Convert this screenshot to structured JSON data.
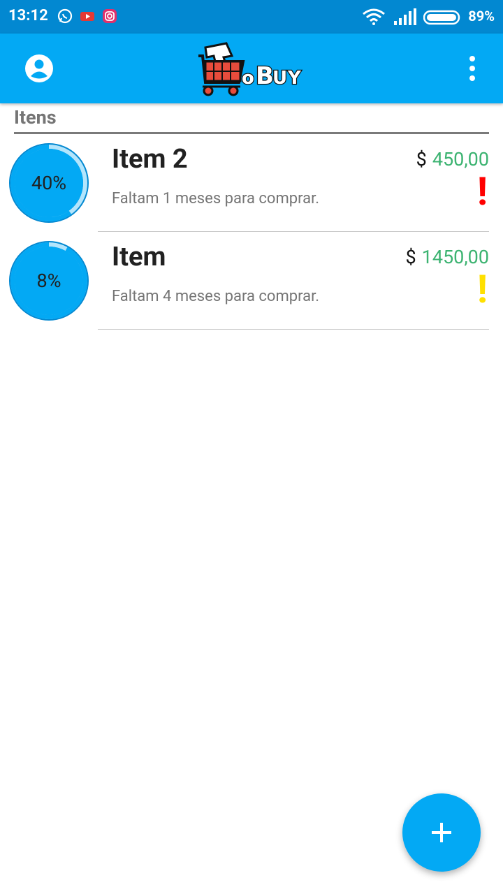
{
  "status_bar": {
    "time": "13:12",
    "battery": "89%",
    "notification_icons": [
      "whatsapp-icon",
      "youtube-icon",
      "instagram-icon"
    ]
  },
  "app_bar": {
    "logo_text": "ToBuy",
    "color": "#03a9f4"
  },
  "section": {
    "title": "Itens"
  },
  "items": [
    {
      "name": "Item 2",
      "currency": "$",
      "price": "450,00",
      "subtitle": "Faltam 1 meses para comprar.",
      "progress_label": "40%",
      "progress": 0.4,
      "alert": "!",
      "alert_color": "#ff0000"
    },
    {
      "name": "Item",
      "currency": "$",
      "price": "1450,00",
      "subtitle": "Faltam 4 meses para comprar.",
      "progress_label": "8%",
      "progress": 0.08,
      "alert": "!",
      "alert_color": "#ffe000"
    }
  ],
  "fab": {
    "icon": "plus-icon"
  },
  "colors": {
    "primary": "#03a9f4",
    "primary_dark": "#0288d1",
    "price": "#3cb371"
  }
}
